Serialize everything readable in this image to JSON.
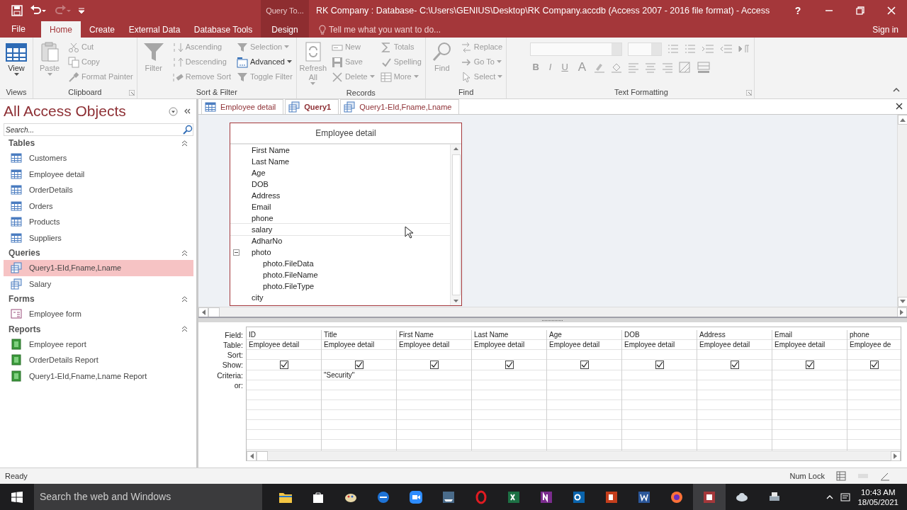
{
  "title_bar": {
    "context_label": "Query To...",
    "title": "RK Company : Database- C:\\Users\\GENIUS\\Desktop\\RK Company.accdb (Access 2007 - 2016 file format) - Access",
    "help": "?"
  },
  "ribbon_tabs": [
    {
      "label": "File",
      "kind": "file",
      "selected": false
    },
    {
      "label": "Home",
      "kind": "tab",
      "selected": true
    },
    {
      "label": "Create",
      "kind": "tab",
      "selected": false
    },
    {
      "label": "External Data",
      "kind": "tab",
      "selected": false
    },
    {
      "label": "Database Tools",
      "kind": "tab",
      "selected": false
    },
    {
      "label": "Design",
      "kind": "contextual",
      "selected": false
    }
  ],
  "tell_me": {
    "placeholder": "Tell me what you want to do..."
  },
  "sign_in": "Sign in",
  "ribbon_groups": [
    {
      "label": "Views",
      "kind": "commands",
      "launcher": false,
      "columns": [
        [
          {
            "label": "View",
            "kind": "large",
            "disabled": false,
            "dropdown": true
          }
        ]
      ]
    },
    {
      "label": "Clipboard",
      "kind": "commands",
      "launcher": true,
      "columns": [
        [
          {
            "label": "Paste",
            "kind": "large",
            "disabled": true,
            "dropdown": true
          }
        ],
        [
          {
            "label": "Cut",
            "kind": "small",
            "disabled": true,
            "dropdown": false
          },
          {
            "label": "Copy",
            "kind": "small",
            "disabled": true,
            "dropdown": false
          },
          {
            "label": "Format Painter",
            "kind": "small",
            "disabled": true,
            "dropdown": false
          }
        ]
      ]
    },
    {
      "label": "Sort & Filter",
      "kind": "commands",
      "launcher": false,
      "columns": [
        [
          {
            "label": "Filter",
            "kind": "large",
            "disabled": true,
            "dropdown": false
          }
        ],
        [
          {
            "label": "Ascending",
            "kind": "small",
            "disabled": true,
            "dropdown": false
          },
          {
            "label": "Descending",
            "kind": "small",
            "disabled": true,
            "dropdown": false
          },
          {
            "label": "Remove Sort",
            "kind": "small",
            "disabled": true,
            "dropdown": false
          }
        ],
        [
          {
            "label": "Selection",
            "kind": "small",
            "disabled": true,
            "dropdown": true
          },
          {
            "label": "Advanced",
            "kind": "small",
            "disabled": false,
            "dropdown": true
          },
          {
            "label": "Toggle Filter",
            "kind": "small",
            "disabled": true,
            "dropdown": false
          }
        ]
      ]
    },
    {
      "label": "Records",
      "kind": "commands",
      "launcher": false,
      "columns": [
        [
          {
            "label": "Refresh All",
            "kind": "large",
            "disabled": true,
            "dropdown": true
          }
        ],
        [
          {
            "label": "New",
            "kind": "small",
            "disabled": true,
            "dropdown": false
          },
          {
            "label": "Save",
            "kind": "small",
            "disabled": true,
            "dropdown": false
          },
          {
            "label": "Delete",
            "kind": "small",
            "disabled": true,
            "dropdown": true
          }
        ],
        [
          {
            "label": "Totals",
            "kind": "small",
            "disabled": true,
            "dropdown": false
          },
          {
            "label": "Spelling",
            "kind": "small",
            "disabled": true,
            "dropdown": false
          },
          {
            "label": "More",
            "kind": "small",
            "disabled": true,
            "dropdown": true
          }
        ]
      ]
    },
    {
      "label": "Find",
      "kind": "commands",
      "launcher": false,
      "columns": [
        [
          {
            "label": "Find",
            "kind": "large",
            "disabled": true,
            "dropdown": false
          }
        ],
        [
          {
            "label": "Replace",
            "kind": "small",
            "disabled": true,
            "dropdown": false
          },
          {
            "label": "Go To",
            "kind": "small",
            "disabled": true,
            "dropdown": true
          },
          {
            "label": "Select",
            "kind": "small",
            "disabled": true,
            "dropdown": true
          }
        ]
      ]
    },
    {
      "label": "Text Formatting",
      "kind": "formatting",
      "launcher": true,
      "format_buttons": [
        "B",
        "I",
        "U",
        "A"
      ]
    }
  ],
  "nav_pane": {
    "title": "All Access Objects",
    "search": {
      "placeholder": "Search..."
    },
    "groups": [
      {
        "label": "Tables",
        "expanded": true,
        "items": [
          {
            "label": "Customers",
            "kind": "table",
            "selected": false
          },
          {
            "label": "Employee detail",
            "kind": "table",
            "selected": false
          },
          {
            "label": "OrderDetails",
            "kind": "table",
            "selected": false
          },
          {
            "label": "Orders",
            "kind": "table",
            "selected": false
          },
          {
            "label": "Products",
            "kind": "table",
            "selected": false
          },
          {
            "label": "Suppliers",
            "kind": "table",
            "selected": false
          }
        ]
      },
      {
        "label": "Queries",
        "expanded": true,
        "items": [
          {
            "label": "Query1-EId,Fname,Lname",
            "kind": "query",
            "selected": true
          },
          {
            "label": "Salary",
            "kind": "query",
            "selected": false
          }
        ]
      },
      {
        "label": "Forms",
        "expanded": true,
        "items": [
          {
            "label": "Employee form",
            "kind": "form",
            "selected": false
          }
        ]
      },
      {
        "label": "Reports",
        "expanded": true,
        "items": [
          {
            "label": "Employee report",
            "kind": "report",
            "selected": false
          },
          {
            "label": "OrderDetails Report",
            "kind": "report",
            "selected": false
          },
          {
            "label": "Query1-EId,Fname,Lname Report",
            "kind": "report",
            "selected": false
          }
        ]
      }
    ]
  },
  "document_tabs": [
    {
      "label": "Employee detail",
      "kind": "table",
      "selected": false
    },
    {
      "label": "Query1",
      "kind": "query",
      "selected": true
    },
    {
      "label": "Query1-EId,Fname,Lname",
      "kind": "query",
      "selected": false
    }
  ],
  "field_list": {
    "title": "Employee detail",
    "fields": [
      {
        "name": "First Name",
        "hovered": false
      },
      {
        "name": "Last Name",
        "hovered": false
      },
      {
        "name": "Age",
        "hovered": false
      },
      {
        "name": "DOB",
        "hovered": false
      },
      {
        "name": "Address",
        "hovered": false
      },
      {
        "name": "Email",
        "hovered": false
      },
      {
        "name": "phone",
        "hovered": false
      },
      {
        "name": "salary",
        "hovered": true
      },
      {
        "name": "AdharNo",
        "hovered": false
      },
      {
        "name": "photo",
        "hovered": false,
        "expanded": true,
        "children": [
          {
            "name": "photo.FileData",
            "hovered": false
          },
          {
            "name": "photo.FileName",
            "hovered": false
          },
          {
            "name": "photo.FileType",
            "hovered": false
          }
        ]
      },
      {
        "name": "city",
        "hovered": false
      }
    ]
  },
  "design_grid": {
    "row_labels": [
      "Field:",
      "Table:",
      "Sort:",
      "Show:",
      "Criteria:",
      "or:"
    ],
    "columns": [
      {
        "field": "ID",
        "table": "Employee detail",
        "show": true
      },
      {
        "field": "Title",
        "table": "Employee detail",
        "show": true,
        "criteria": "\"Security\""
      },
      {
        "field": "First Name",
        "table": "Employee detail",
        "show": true
      },
      {
        "field": "Last Name",
        "table": "Employee detail",
        "show": true
      },
      {
        "field": "Age",
        "table": "Employee detail",
        "show": true
      },
      {
        "field": "DOB",
        "table": "Employee detail",
        "show": true
      },
      {
        "field": "Address",
        "table": "Employee detail",
        "show": true
      },
      {
        "field": "Email",
        "table": "Employee detail",
        "show": true
      },
      {
        "field": "phone",
        "table": "Employee de",
        "show": true
      }
    ]
  },
  "status_bar": {
    "left": "Ready",
    "indicator": "Num Lock"
  },
  "taskbar": {
    "search_placeholder": "Search the web and Windows",
    "time": "10:43 AM",
    "date": "18/05/2021"
  }
}
